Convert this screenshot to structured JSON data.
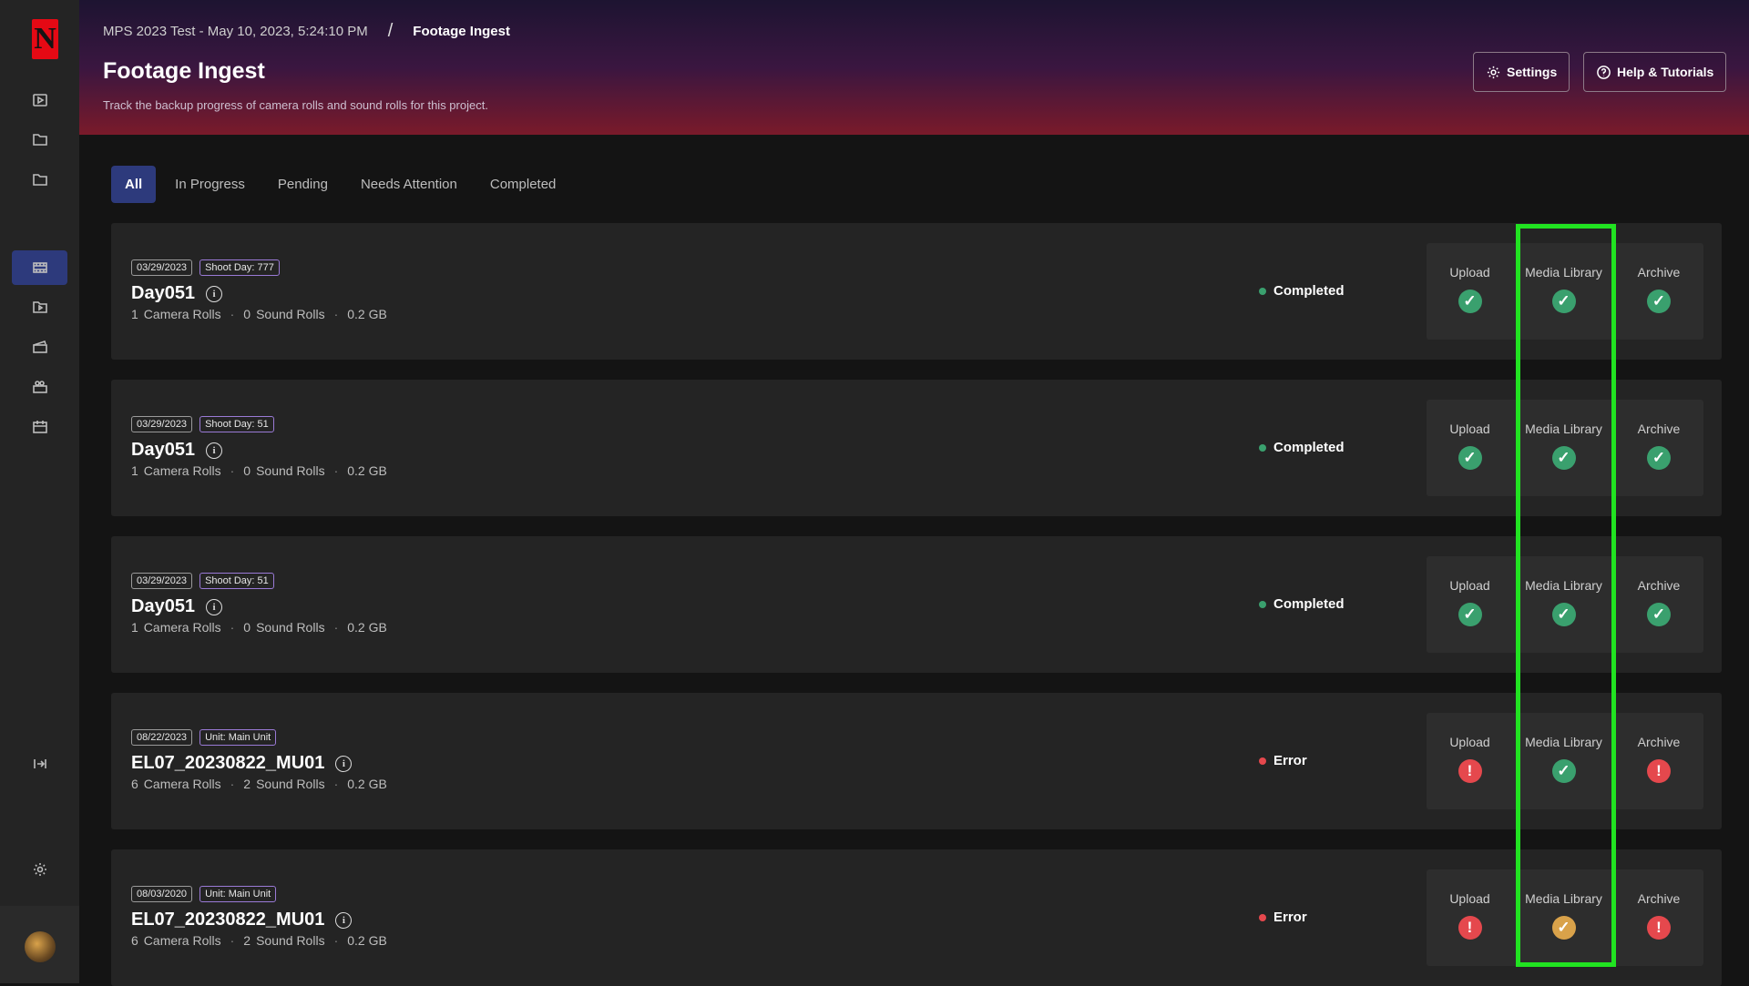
{
  "sidebar": {
    "logo": "N",
    "items": [
      {
        "icon": "play-icon",
        "active": false
      },
      {
        "icon": "folder-icon",
        "active": false
      },
      {
        "icon": "folder-icon",
        "active": false
      },
      {
        "icon": "film-icon",
        "active": true
      },
      {
        "icon": "video-folder-icon",
        "active": false
      },
      {
        "icon": "clapper-icon",
        "active": false
      },
      {
        "icon": "camera-icon",
        "active": false
      },
      {
        "icon": "calendar-icon",
        "active": false
      },
      {
        "icon": "expand-icon",
        "active": false
      },
      {
        "icon": "gear-icon",
        "active": false
      }
    ]
  },
  "breadcrumb": {
    "project": "MPS 2023 Test - May 10, 2023, 5:24:10 PM",
    "separator": "/",
    "current": "Footage Ingest"
  },
  "header": {
    "title": "Footage Ingest",
    "subtitle": "Track the backup progress of camera rolls and sound rolls for this project.",
    "settings_label": "Settings",
    "help_label": "Help & Tutorials"
  },
  "tabs": [
    {
      "label": "All",
      "active": true
    },
    {
      "label": "In Progress",
      "active": false
    },
    {
      "label": "Pending",
      "active": false
    },
    {
      "label": "Needs Attention",
      "active": false
    },
    {
      "label": "Completed",
      "active": false
    }
  ],
  "rows": [
    {
      "date": "03/29/2023",
      "tag": "Shoot Day: 777",
      "title": "Day051",
      "camera_count": "1",
      "camera_label": "Camera Rolls",
      "sound_count": "0",
      "sound_label": "Sound Rolls",
      "size": "0.2 GB",
      "status": "Completed",
      "status_color": "#3aa06e",
      "stages": [
        {
          "label": "Upload",
          "state": "ok"
        },
        {
          "label": "Media Library",
          "state": "ok"
        },
        {
          "label": "Archive",
          "state": "ok"
        }
      ]
    },
    {
      "date": "03/29/2023",
      "tag": "Shoot Day: 51",
      "title": "Day051",
      "camera_count": "1",
      "camera_label": "Camera Rolls",
      "sound_count": "0",
      "sound_label": "Sound Rolls",
      "size": "0.2 GB",
      "status": "Completed",
      "status_color": "#3aa06e",
      "stages": [
        {
          "label": "Upload",
          "state": "ok"
        },
        {
          "label": "Media Library",
          "state": "ok"
        },
        {
          "label": "Archive",
          "state": "ok"
        }
      ]
    },
    {
      "date": "03/29/2023",
      "tag": "Shoot Day: 51",
      "title": "Day051",
      "camera_count": "1",
      "camera_label": "Camera Rolls",
      "sound_count": "0",
      "sound_label": "Sound Rolls",
      "size": "0.2 GB",
      "status": "Completed",
      "status_color": "#3aa06e",
      "stages": [
        {
          "label": "Upload",
          "state": "ok"
        },
        {
          "label": "Media Library",
          "state": "ok"
        },
        {
          "label": "Archive",
          "state": "ok"
        }
      ]
    },
    {
      "date": "08/22/2023",
      "tag": "Unit: Main Unit",
      "title": "EL07_20230822_MU01",
      "camera_count": "6",
      "camera_label": "Camera Rolls",
      "sound_count": "2",
      "sound_label": "Sound Rolls",
      "size": "0.2 GB",
      "status": "Error",
      "status_color": "#e5484d",
      "stages": [
        {
          "label": "Upload",
          "state": "err"
        },
        {
          "label": "Media Library",
          "state": "ok"
        },
        {
          "label": "Archive",
          "state": "err"
        }
      ]
    },
    {
      "date": "08/03/2020",
      "tag": "Unit: Main Unit",
      "title": "EL07_20230822_MU01",
      "camera_count": "6",
      "camera_label": "Camera Rolls",
      "sound_count": "2",
      "sound_label": "Sound Rolls",
      "size": "0.2 GB",
      "status": "Error",
      "status_color": "#e5484d",
      "stages": [
        {
          "label": "Upload",
          "state": "err"
        },
        {
          "label": "Media Library",
          "state": "warn"
        },
        {
          "label": "Archive",
          "state": "err"
        }
      ]
    }
  ],
  "colors": {
    "accent": "#2d3a7c",
    "ok": "#3aa06e",
    "error": "#e5484d",
    "warning": "#d9a24a",
    "highlight": "#21e321"
  }
}
